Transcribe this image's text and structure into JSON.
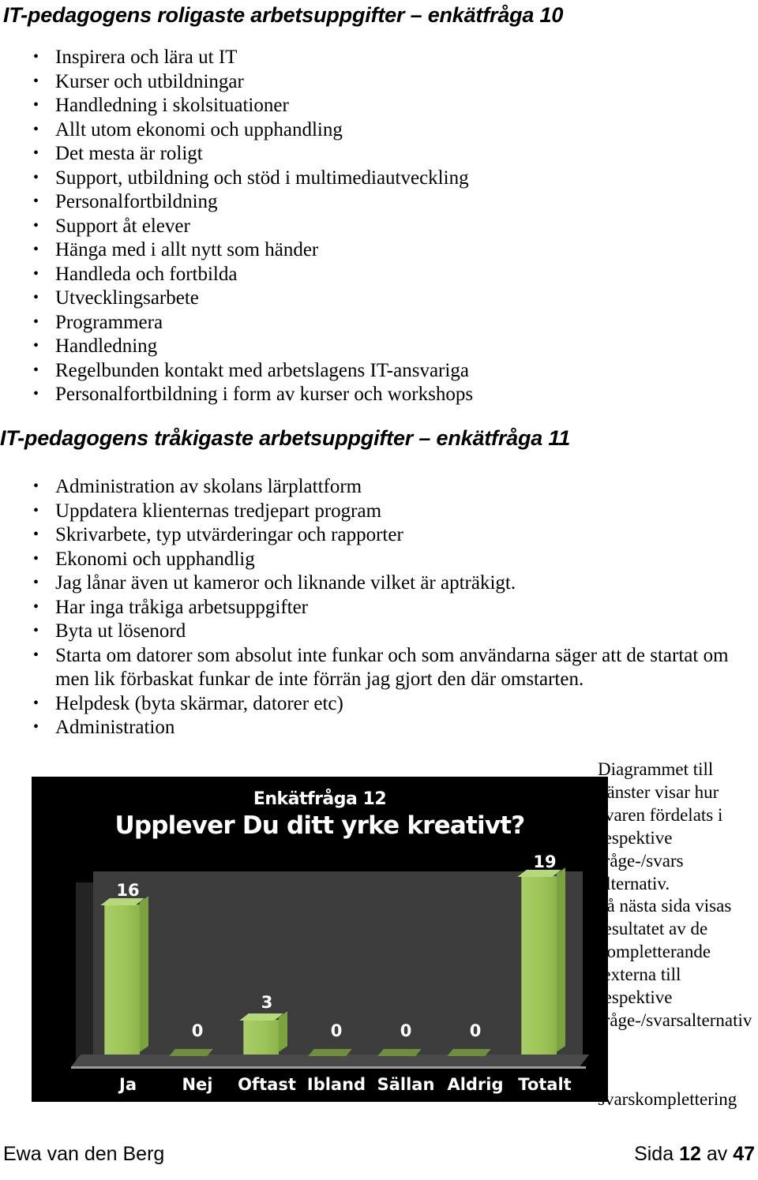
{
  "document": {
    "section1": {
      "heading": "IT-pedagogens roligaste arbetsuppgifter – enkätfråga 10",
      "items": [
        "Inspirera och lära ut IT",
        "Kurser och utbildningar",
        "Handledning i skolsituationer",
        "Allt utom ekonomi och upphandling",
        "Det mesta är roligt",
        "Support, utbildning och stöd i multimediautveckling",
        "Personalfortbildning",
        "Support åt elever",
        "Hänga med i allt nytt som händer",
        "Handleda och fortbilda",
        "Utvecklingsarbete",
        "Programmera",
        "Handledning",
        "Regelbunden kontakt med arbetslagens IT-ansvariga",
        "Personalfortbildning i form av kurser och workshops"
      ]
    },
    "section2": {
      "heading": "IT-pedagogens tråkigaste arbetsuppgifter – enkätfråga 11",
      "items": [
        "Administration av skolans lärplattform",
        "Uppdatera klienternas tredjepart program",
        "Skrivarbete, typ utvärderingar och rapporter",
        "Ekonomi och upphandlig",
        "Jag lånar även ut kameror och liknande vilket är apträkigt.",
        "Har inga tråkiga arbetsuppgifter",
        "Byta ut lösenord",
        "Starta om datorer som absolut inte funkar och som användarna säger att de startat om men lik förbaskat funkar de inte förrän jag gjort den där omstarten.",
        "Helpdesk (byta skärmar, datorer etc)",
        "Administration"
      ]
    },
    "side_notes": {
      "note1": "Diagrammet till vänster visar hur svaren fördelats i respektive fråge-/svars alternativ.",
      "note2": "på nästa sida visas resultatet av de kompletterande texterna till respektive fråge-/svarsalternativ",
      "note3": "svarskomplettering"
    },
    "footer": {
      "author": "Ewa van den Berg",
      "page_label_prefix": "Sida",
      "page_number": "12",
      "page_of": "av",
      "page_total": "47"
    }
  },
  "chart_data": {
    "type": "bar",
    "title": "Upplever Du ditt yrke kreativt?",
    "subtitle": "Enkätfråga 12",
    "categories": [
      "Ja",
      "Nej",
      "Oftast",
      "Ibland",
      "Sällan",
      "Aldrig",
      "Totalt"
    ],
    "values": [
      16,
      0,
      3,
      0,
      0,
      0,
      19
    ],
    "value_labels": [
      "16",
      "0",
      "3",
      "0",
      "0",
      "0",
      "19"
    ],
    "xlabel": "",
    "ylabel": "",
    "ylim": [
      0,
      20
    ],
    "grid": false,
    "legend": "none",
    "colors": {
      "background": "#000000",
      "plot_wall": "#3c3c3c",
      "bar": "#9dc558",
      "bar_side": "#7aa23f",
      "bar_top": "#b6d87c",
      "text": "#ffffff",
      "axis": "#9a9a9a"
    }
  }
}
